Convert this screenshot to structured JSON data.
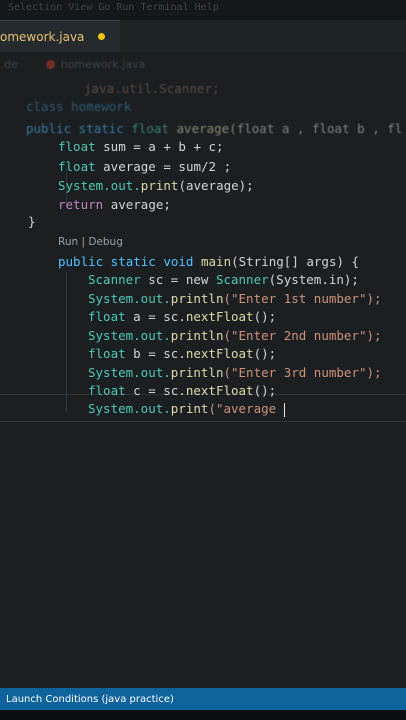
{
  "window": {
    "top_faded": "Selection   View   Go   Run   Terminal   Help"
  },
  "tab": {
    "label": "omework.java",
    "dirty_indicator": "unsaved"
  },
  "breadcrumb": {
    "root": "de",
    "file": "homework.java"
  },
  "code": {
    "import_line": "java.util.Scanner;",
    "class_line": "class homework",
    "method_sig_1": "public static ",
    "method_sig_type": "float ",
    "method_sig_name": "average",
    "method_sig_rest": "(float a , float b , fl",
    "sum_line_type": "float ",
    "sum_line_rest": "sum = a + b + c;",
    "avg_line_type": "float ",
    "avg_line_rest": "average = sum/2 ;",
    "print_obj": "System.",
    "print_field": "out.",
    "print_fn": "print",
    "print_rest": "(average);",
    "return_kw": "return ",
    "return_rest": "average;",
    "close_brace": "}",
    "codelens": "Run | Debug",
    "main_kw": "public static void ",
    "main_name": "main",
    "main_rest": "(String[] args) {",
    "scanner_line_type": "Scanner ",
    "scanner_line_rest": "sc = new ",
    "scanner_line_ctor": "Scanner",
    "scanner_line_end": "(System.in);",
    "println1_obj": "System.out.",
    "println1_fn": "println",
    "println1_str": "(\"Enter 1st number\");",
    "float_a_type": "float ",
    "float_a_rest": "a = sc.",
    "float_a_fn": "nextFloat",
    "float_a_end": "();",
    "println2_obj": "System.out.",
    "println2_fn": "println",
    "println2_str": "(\"Enter 2nd number\");",
    "float_b_type": "float ",
    "float_b_rest": "b = sc.",
    "float_b_fn": "nextFloat",
    "float_b_end": "();",
    "println3_obj": "System.out.",
    "println3_fn": "println",
    "println3_str": "(\"Enter 3rd number\");",
    "float_c_type": "float ",
    "float_c_rest": "c = sc.",
    "float_c_fn": "nextFloat",
    "float_c_end": "();",
    "last_obj": "System.out.",
    "last_fn": "print",
    "last_str": "(\"average "
  },
  "statusbar": {
    "text": "Launch Conditions (java practice)"
  },
  "colors": {
    "statusbar": "#0e639c",
    "keyword": "#4fc1ff",
    "type": "#4ec9b0",
    "function": "#dcdcaa",
    "string": "#ce9178"
  }
}
